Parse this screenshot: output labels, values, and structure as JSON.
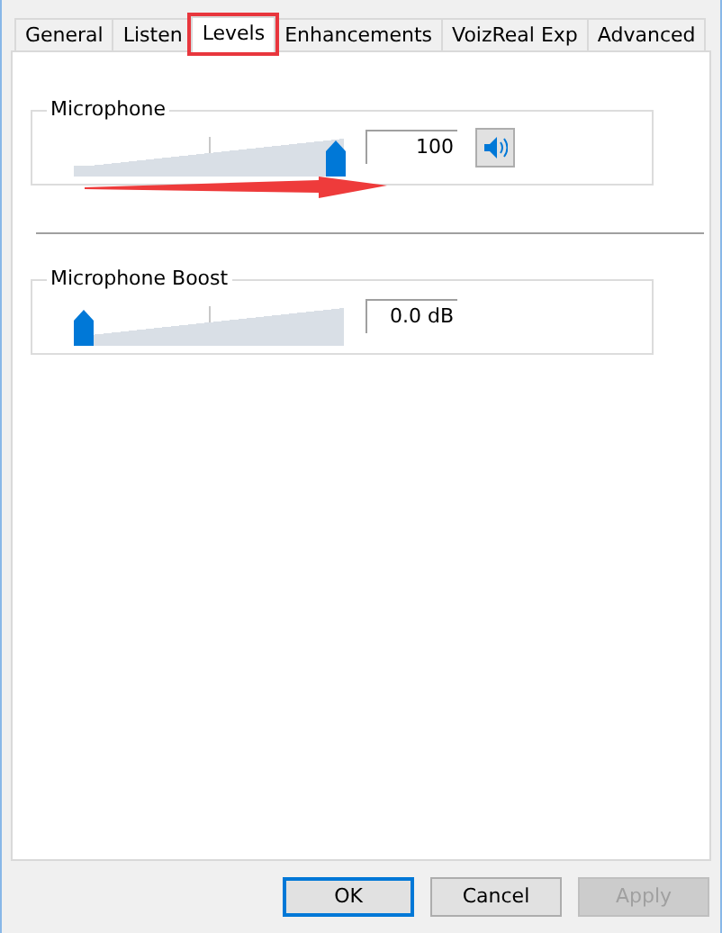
{
  "tabs": [
    {
      "label": "General",
      "selected": false,
      "highlighted": false
    },
    {
      "label": "Listen",
      "selected": false,
      "highlighted": false
    },
    {
      "label": "Levels",
      "selected": true,
      "highlighted": true
    },
    {
      "label": "Enhancements",
      "selected": false,
      "highlighted": false
    },
    {
      "label": "VoizReal Exp",
      "selected": false,
      "highlighted": false
    },
    {
      "label": "Advanced",
      "selected": false,
      "highlighted": false
    }
  ],
  "groups": [
    {
      "title": "Microphone",
      "level": 1.0,
      "reading": "100",
      "mute_button": true,
      "muted": false,
      "annotated": true
    },
    {
      "title": "Microphone Boost",
      "level": 0.0,
      "reading": "0.0 dB",
      "mute_button": false,
      "annotated": false
    }
  ],
  "buttons": [
    {
      "label": "OK",
      "default": true,
      "disabled": false
    },
    {
      "label": "Cancel",
      "default": false,
      "disabled": false
    },
    {
      "label": "Apply",
      "default": false,
      "disabled": true
    }
  ]
}
